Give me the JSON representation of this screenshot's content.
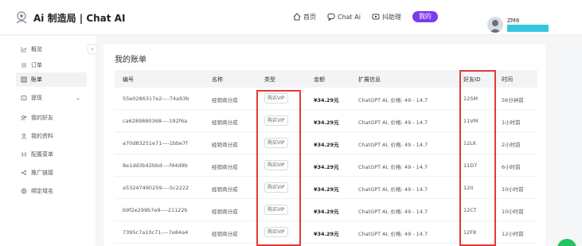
{
  "brand": {
    "title": "Ai 制造局 | Chat AI"
  },
  "topnav": {
    "items": [
      {
        "label": "首页",
        "icon": "home-icon"
      },
      {
        "label": "Chat Ai",
        "icon": "chat-icon"
      },
      {
        "label": "抖助理",
        "icon": "assistant-icon"
      }
    ],
    "pill_label": "我的",
    "accent": "#7c3aed"
  },
  "user": {
    "name": "ZM8"
  },
  "sidebar": {
    "items": [
      {
        "label": "概览",
        "icon": "chart-icon"
      },
      {
        "label": "订单",
        "icon": "list-icon"
      },
      {
        "label": "账单",
        "icon": "bill-icon",
        "active": true
      },
      {
        "label": "提现",
        "icon": "withdraw-icon",
        "has_chevron": true
      },
      {
        "label": "我的好友",
        "icon": "friends-icon"
      },
      {
        "label": "我的资料",
        "icon": "user-icon"
      },
      {
        "label": "配置菜单",
        "icon": "menu-config-icon"
      },
      {
        "label": "推广链接",
        "icon": "share-icon"
      },
      {
        "label": "绑定域名",
        "icon": "globe-icon"
      }
    ]
  },
  "main": {
    "title": "我的账单",
    "columns": [
      "编号",
      "名称",
      "类型",
      "金额",
      "扩展信息",
      "好友ID",
      "时间"
    ],
    "rows": [
      {
        "id": "55e0286317e2----74a93b",
        "name": "经销商分成",
        "type": "购买VIP",
        "amount": "¥34.29元",
        "ext": "ChatGPT AI, 价格: 49 - 14.7",
        "friend": "12SM",
        "time": "56分钟前"
      },
      {
        "id": "ca6289880368----192f6a",
        "name": "经销商分成",
        "type": "购买VIP",
        "amount": "¥34.29元",
        "ext": "ChatGPT AI, 价格: 49 - 14.7",
        "friend": "11VM",
        "time": "1小时前"
      },
      {
        "id": "a70d83251e71----1bbe7f",
        "name": "经销商分成",
        "type": "购买VIP",
        "amount": "¥34.29元",
        "ext": "ChatGPT AI, 价格: 49 - 14.7",
        "friend": "12LK",
        "time": "2小时前"
      },
      {
        "id": "8e1dd3b42bbd----f44d9b",
        "name": "经销商分成",
        "type": "购买VIP",
        "amount": "¥34.29元",
        "ext": "ChatGPT AI, 价格: 49 - 14.7",
        "friend": "11D7",
        "time": "6小时前"
      },
      {
        "id": "a53247490259----5c2222",
        "name": "经销商分成",
        "type": "购买VIP",
        "amount": "¥34.29元",
        "ext": "ChatGPT AI, 价格: 49 - 14.7",
        "friend": "12II",
        "time": "10小时前"
      },
      {
        "id": "b9f2e299b7e9----21122b",
        "name": "经销商分成",
        "type": "购买VIP",
        "amount": "¥34.29元",
        "ext": "ChatGPT AI, 价格: 49 - 14.7",
        "friend": "12CT",
        "time": "10小时前"
      },
      {
        "id": "7395c7a10c71----7e84a4",
        "name": "经销商分成",
        "type": "购买VIP",
        "amount": "¥34.29元",
        "ext": "ChatGPT AI, 价格: 49 - 14.7",
        "friend": "12F8",
        "time": "12小时前"
      }
    ]
  },
  "colors": {
    "highlight": "#e53935",
    "user_bar": "#36c6e0",
    "fab": "#22c55e"
  }
}
